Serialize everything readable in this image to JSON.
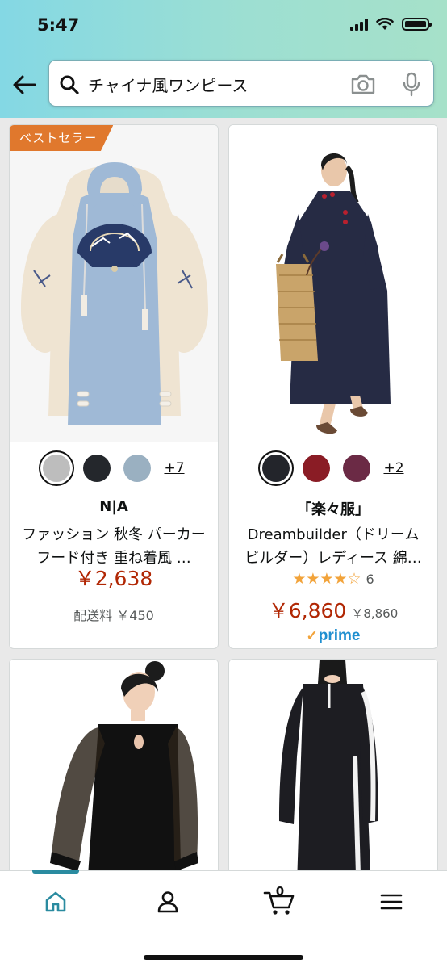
{
  "status_bar": {
    "time": "5:47"
  },
  "search": {
    "query": "チャイナ風ワンピース"
  },
  "products": [
    {
      "badge": "ベストセラー",
      "brand": "N|A",
      "title": "ファッション 秋冬 パーカー フード付き 重ね着風 …",
      "swatches": [
        "#bdbdbd",
        "#24272c",
        "#9ab0c1"
      ],
      "swatch_more": "+7",
      "price": "￥2,638",
      "shipping": "配送料 ￥450"
    },
    {
      "brand": "「楽々服」",
      "title": "Dreambuilder（ドリームビルダー）レディース 綿…",
      "swatches": [
        "#23252b",
        "#8a1c25",
        "#6b2a45"
      ],
      "swatch_more": "+2",
      "rating_stars": "★★★★☆",
      "rating_value": 4,
      "rating_count": "6",
      "price": "￥6,860",
      "old_price": "￥8,860",
      "prime": "prime"
    }
  ],
  "nav": {
    "items": [
      "home-icon",
      "account-icon",
      "cart-icon",
      "menu-icon"
    ],
    "cart_count": "0"
  },
  "colors": {
    "price": "#b12704",
    "badge": "#e0782d",
    "prime": "#1f8fd0",
    "nav_accent": "#2a8ba0"
  }
}
